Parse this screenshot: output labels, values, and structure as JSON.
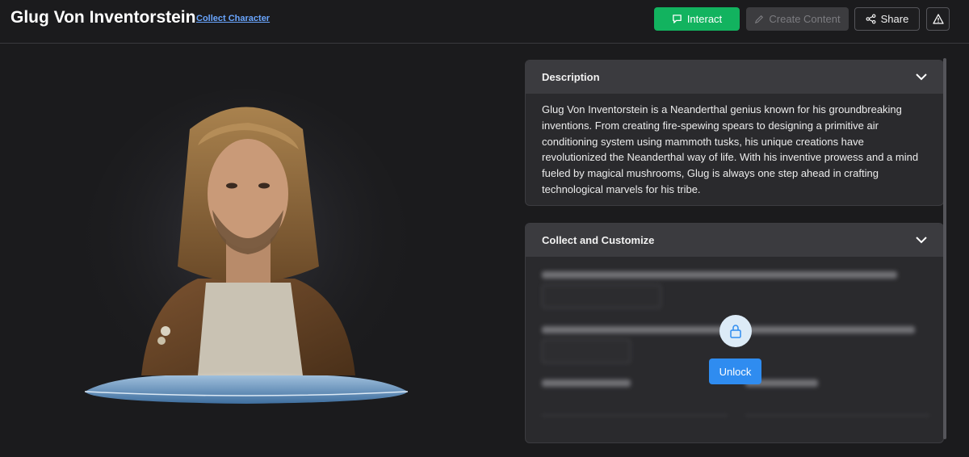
{
  "header": {
    "title": "Glug Von Inventorstein",
    "collect_link": "Collect Character",
    "buttons": {
      "interact": "Interact",
      "create_content": "Create Content",
      "share": "Share"
    }
  },
  "character_image": {
    "subject": "character portrait on a holographic display platform"
  },
  "panels": {
    "description": {
      "header": "Description",
      "text": "Glug Von Inventorstein is a Neanderthal genius known for his groundbreaking inventions. From creating fire-spewing spears to designing a primitive air conditioning system using mammoth tusks, his unique creations have revolutionized the Neanderthal way of life. With his inventive prowess and a mind fueled by magical mushrooms, Glug is always one step ahead in crafting technological marvels for his tribe."
    },
    "collect": {
      "header": "Collect and Customize",
      "unlock_label": "Unlock"
    }
  },
  "colors": {
    "background": "#1b1b1d",
    "panel": "#2a2a2d",
    "panel_header": "#3b3b3f",
    "interact_button": "#12b35f",
    "unlock_button": "#2f8cf0",
    "link": "#6aa6ff"
  }
}
